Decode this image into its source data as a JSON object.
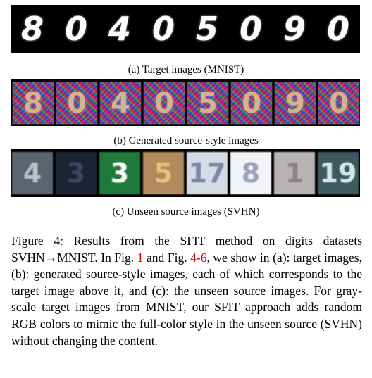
{
  "panel_a": {
    "digits": [
      "8",
      "0",
      "4",
      "0",
      "5",
      "0",
      "9",
      "0"
    ],
    "caption": "(a) Target images (MNIST)"
  },
  "panel_b": {
    "digits": [
      "8",
      "0",
      "4",
      "0",
      "5",
      "0",
      "9",
      "0"
    ],
    "caption": "(b) Generated source-style images"
  },
  "panel_c": {
    "tiles": [
      {
        "digit": "4",
        "bg": "#5c6470",
        "fg": "#b9c0c8"
      },
      {
        "digit": "3",
        "bg": "#1c2434",
        "fg": "#3a4866"
      },
      {
        "digit": "3",
        "bg": "#1f7a3a",
        "fg": "#ffffff"
      },
      {
        "digit": "5",
        "bg": "#b08a5c",
        "fg": "#e8c27a"
      },
      {
        "digit": "17",
        "bg": "#d6dae4",
        "fg": "#7c86a6"
      },
      {
        "digit": "8",
        "bg": "#f2f3f6",
        "fg": "#9aa2b8"
      },
      {
        "digit": "1",
        "bg": "#b9b4b4",
        "fg": "#8a8484"
      },
      {
        "digit": "19",
        "bg": "#3c5a60",
        "fg": "#d6e6e6"
      }
    ],
    "caption": "(c) Unseen source images (SVHN)"
  },
  "figure_text": {
    "part1": "Figure 4: Results from the SFIT method on digits datasets SVHN→MNIST. In Fig. ",
    "ref1": "1",
    "part2": " and Fig. ",
    "ref2": "4-6",
    "part3": ", we show in (a): target images, (b): generated source-style images, each of which corresponds to the target image above it, and (c): the unseen source images.  For gray-scale target images from MNIST, our SFIT approach adds random RGB colors to mimic the full-color style in the unseen source (SVHN) without changing the content."
  }
}
